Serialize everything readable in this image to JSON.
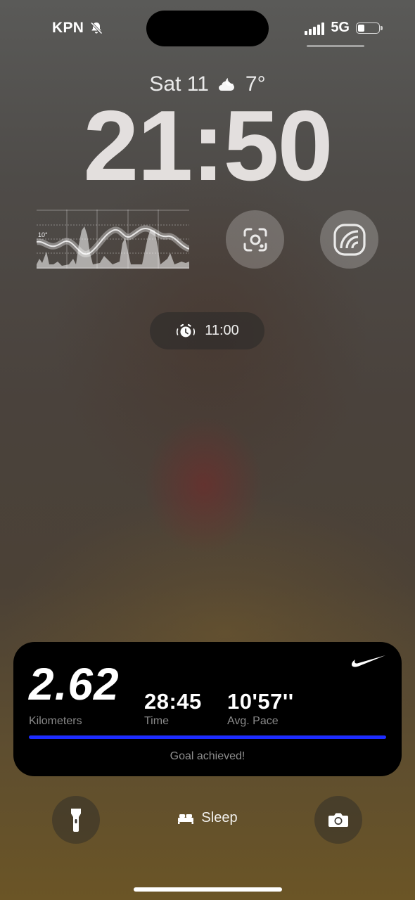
{
  "status_bar": {
    "carrier": "KPN",
    "silent_icon": "bell-slash-icon",
    "network": "5G",
    "signal_icon": "cellular-signal-icon",
    "battery_level": 0.35
  },
  "lock_screen": {
    "date": "Sat 11",
    "weather_icon": "partly-cloudy-night-icon",
    "temperature": "7°",
    "time": "21:50"
  },
  "widgets": {
    "weather_graph": {
      "temp_label": "10°"
    },
    "google_lens_icon": "lens-icon",
    "news_icon": "news-feed-icon",
    "alarm": {
      "icon": "alarm-clock-icon",
      "time": "11:00"
    }
  },
  "nike_activity": {
    "brand_icon": "nike-swoosh-icon",
    "distance": "2.62",
    "distance_label": "Kilometers",
    "time": "28:45",
    "time_label": "Time",
    "pace": "10'57''",
    "pace_label": "Avg. Pace",
    "goal_progress": 1.0,
    "goal_text": "Goal achieved!",
    "accent_color": "#1d2cff"
  },
  "bottom_controls": {
    "flashlight_icon": "flashlight-icon",
    "sleep_icon": "bed-icon",
    "sleep_label": "Sleep",
    "camera_icon": "camera-icon"
  }
}
